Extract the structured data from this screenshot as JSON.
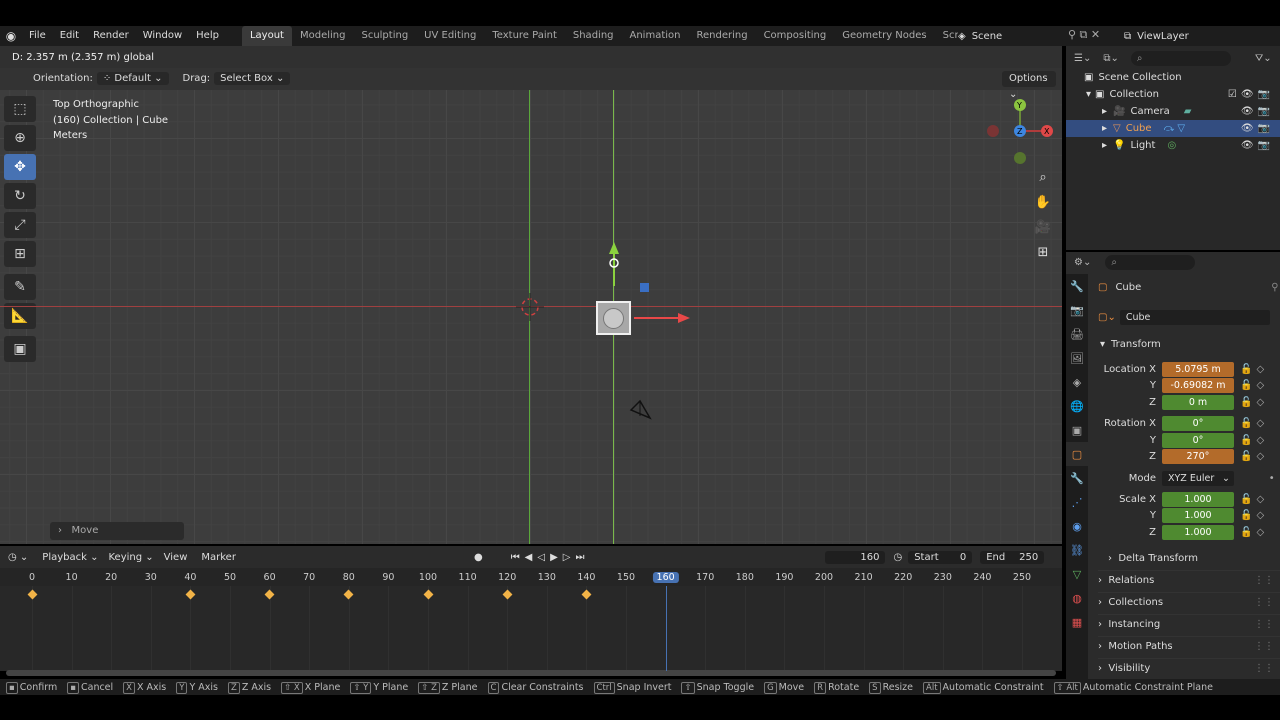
{
  "menu": [
    "File",
    "Edit",
    "Render",
    "Window",
    "Help"
  ],
  "workspaces": [
    "Layout",
    "Modeling",
    "Sculpting",
    "UV Editing",
    "Texture Paint",
    "Shading",
    "Animation",
    "Rendering",
    "Compositing",
    "Geometry Nodes",
    "Scripting"
  ],
  "active_workspace": "Layout",
  "scene": "Scene",
  "view_layer": "ViewLayer",
  "viewport": {
    "operator_text": "D: 2.357 m (2.357 m) global",
    "orientation_label": "Orientation:",
    "orientation_value": "Default",
    "drag_label": "Drag:",
    "drag_value": "Select Box",
    "options": "Options",
    "info_line1": "Top Orthographic",
    "info_line2": "(160) Collection | Cube",
    "info_line3": "Meters",
    "redo_panel": "Move"
  },
  "timeline": {
    "playback": "Playback",
    "keying": "Keying",
    "view": "View",
    "marker": "Marker",
    "current_frame": "160",
    "start_label": "Start",
    "start": "0",
    "end_label": "End",
    "end": "250",
    "ticks": [
      "0",
      "10",
      "20",
      "30",
      "40",
      "50",
      "60",
      "70",
      "80",
      "90",
      "100",
      "110",
      "120",
      "130",
      "140",
      "150",
      "160",
      "170",
      "180",
      "190",
      "200",
      "210",
      "220",
      "230",
      "240",
      "250"
    ],
    "keyframes": [
      0,
      40,
      60,
      80,
      100,
      120,
      140
    ]
  },
  "outliner": {
    "scene_collection": "Scene Collection",
    "collection": "Collection",
    "items": [
      "Camera",
      "Cube",
      "Light"
    ]
  },
  "properties": {
    "object_name": "Cube",
    "data_name": "Cube",
    "transform": "Transform",
    "location_label": "Location X",
    "loc_x": "5.0795 m",
    "loc_y": "-0.69082 m",
    "loc_z": "0 m",
    "rotation_label": "Rotation X",
    "rot_x": "0°",
    "rot_y": "0°",
    "rot_z": "270°",
    "mode_label": "Mode",
    "mode_value": "XYZ Euler",
    "scale_label": "Scale X",
    "scale_x": "1.000",
    "scale_y": "1.000",
    "scale_z": "1.000",
    "y_label": "Y",
    "z_label": "Z",
    "sections": [
      "Delta Transform",
      "Relations",
      "Collections",
      "Instancing",
      "Motion Paths",
      "Visibility"
    ]
  },
  "statusbar": [
    {
      "key": "",
      "label": "Confirm"
    },
    {
      "key": "",
      "label": "Cancel"
    },
    {
      "key": "X",
      "label": "X Axis"
    },
    {
      "key": "Y",
      "label": "Y Axis"
    },
    {
      "key": "Z",
      "label": "Z Axis"
    },
    {
      "key": "⇧ X",
      "label": "X Plane"
    },
    {
      "key": "⇧ Y",
      "label": "Y Plane"
    },
    {
      "key": "⇧ Z",
      "label": "Z Plane"
    },
    {
      "key": "C",
      "label": "Clear Constraints"
    },
    {
      "key": "Ctrl",
      "label": "Snap Invert"
    },
    {
      "key": "⇧",
      "label": "Snap Toggle"
    },
    {
      "key": "G",
      "label": "Move"
    },
    {
      "key": "R",
      "label": "Rotate"
    },
    {
      "key": "S",
      "label": "Resize"
    },
    {
      "key": "Alt",
      "label": "Automatic Constraint"
    },
    {
      "key": "⇧ Alt",
      "label": "Automatic Constraint Plane"
    }
  ],
  "colors": {
    "accent": "#4772b3",
    "keyframe": "#f2b347",
    "playhead": "#4772b3",
    "field_orange": "#b36b2a",
    "field_green": "#4f8a30"
  }
}
